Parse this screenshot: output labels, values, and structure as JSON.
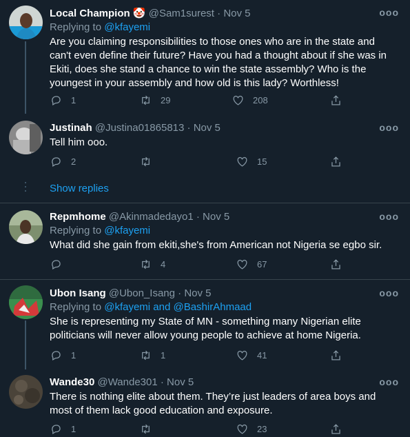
{
  "tweets": [
    {
      "name": "Local Champion",
      "emoji": "🤡",
      "handle": "@Sam1surest",
      "date": "Nov 5",
      "replying_label": "Replying to",
      "replying_to": "@kfayemi",
      "text": "Are you claiming responsibilities to those ones who are in the state and can't even define their future? Have you had a thought about if she was in Ekiti, does she stand a chance to win the state assembly? Who is the youngest in your assembly and how old is this lady? Worthless!",
      "replies": "1",
      "retweets": "29",
      "likes": "208"
    },
    {
      "name": "Justinah",
      "handle": "@Justina01865813",
      "date": "Nov 5",
      "text": "Tell him ooo.",
      "replies": "2",
      "retweets": "",
      "likes": "15"
    },
    {
      "name": "Repmhome",
      "handle": "@Akinmadedayo1",
      "date": "Nov 5",
      "replying_label": "Replying to",
      "replying_to": "@kfayemi",
      "text": "What did she gain from ekiti,she's from American not Nigeria se egbo sir.",
      "replies": "",
      "retweets": "4",
      "likes": "67"
    },
    {
      "name": "Ubon Isang",
      "handle": "@Ubon_Isang",
      "date": "Nov 5",
      "replying_label": "Replying to",
      "replying_to": "@kfayemi and @BashirAhmaad",
      "text": "She is representing my State of MN - something many Nigerian elite politicians will never allow young people to achieve at home Nigeria.",
      "replies": "1",
      "retweets": "1",
      "likes": "41"
    },
    {
      "name": "Wande30",
      "handle": "@Wande301",
      "date": "Nov 5",
      "text": "There is nothing elite about them. They’re just leaders of area boys and most of them lack good education and exposure.",
      "replies": "1",
      "retweets": "",
      "likes": "23"
    }
  ],
  "show_replies": "Show replies",
  "separator": "·",
  "more_glyph": "ooo",
  "colors": {
    "background": "#15202b",
    "link": "#1da1f2",
    "muted": "#8899a6",
    "divider": "#38444d"
  },
  "icons": [
    "reply-icon",
    "retweet-icon",
    "like-icon",
    "share-icon",
    "more-icon"
  ]
}
